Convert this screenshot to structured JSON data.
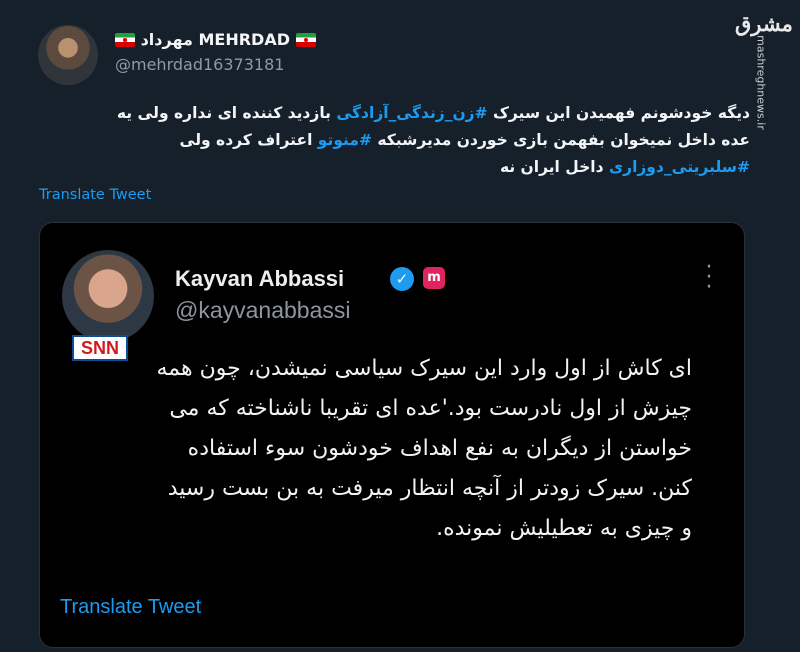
{
  "tweet": {
    "author": {
      "name_persian": "مهرداد",
      "name_latin": "MEHRDAD",
      "handle": "@mehrdad16373181"
    },
    "body_lines": [
      {
        "pre": "دیگه خودشونم فهمیدن این سیرک ",
        "tag": "#زن_زندگی_آزادگی",
        "post": " بازدید کننده ای نداره ولی یه"
      },
      {
        "pre": "عده داخل نمیخوان بفهمن بازی خوردن مدیرشبکه ",
        "tag": "#منوتو",
        "post": " اعتراف کرده ولی"
      },
      {
        "pre": "",
        "tag": "#سلبریتی_دوزاری",
        "post": " داخل ایران نه"
      }
    ],
    "translate_label": "Translate Tweet"
  },
  "quoted": {
    "name": "Kayvan Abbassi",
    "handle": "@kayvanabbassi",
    "badge_text": "SNN",
    "body_lines": [
      "ای کاش از اول وارد این سیرک سیاسی نمیشدن، چون همه",
      "چیزش از اول نادرست بود.'عده ای تقریبا ناشناخته که می",
      "خواستن از دیگران به نفع اهداف خودشون سوء استفاده",
      "کنن. سیرک زودتر از آنچه انتظار میرفت به بن بست رسید",
      "و چیزی به تعطیلیش نمونده."
    ],
    "translate_label": "Translate Tweet"
  },
  "watermark": {
    "logo_text": "مشرق",
    "site": "mashreghnews.ir"
  },
  "icons": {
    "verified": "verified-check-icon",
    "label": "affiliate-badge-icon",
    "more": "more-options-icon",
    "flag": "iran-flag-icon"
  },
  "colors": {
    "background": "#16202b",
    "link": "#1d9bf0",
    "quote_background": "#000000"
  }
}
